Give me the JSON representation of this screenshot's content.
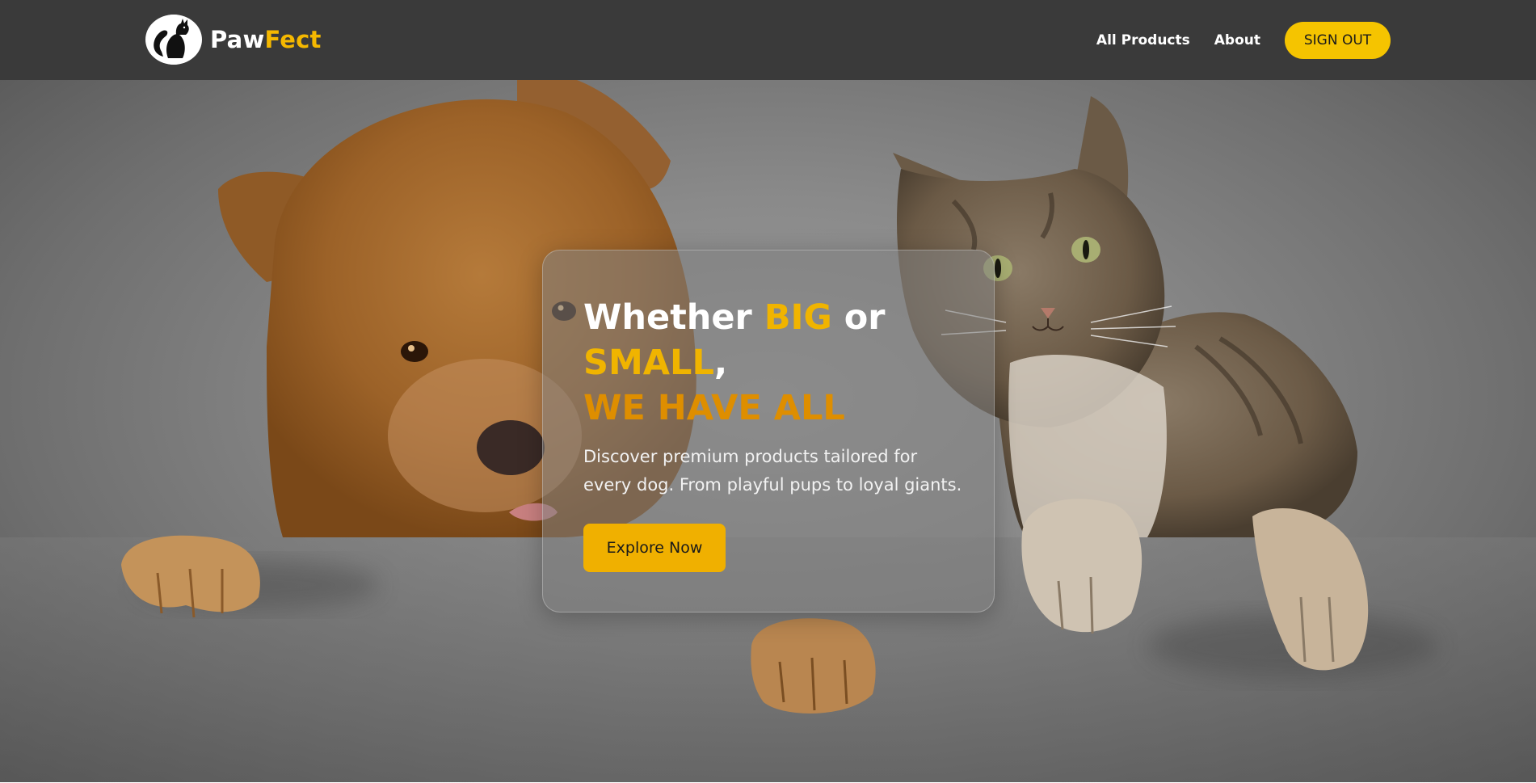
{
  "brand": {
    "name_part1": "Paw",
    "name_part2": "Fect",
    "logo_icon": "cat-silhouette-icon",
    "accent_color": "#f5b800"
  },
  "nav": {
    "links": [
      {
        "label": "All Products"
      },
      {
        "label": "About"
      }
    ],
    "signout_label": "SIGN OUT"
  },
  "hero": {
    "background_icon": "dog-and-cat-photo",
    "headline": {
      "part1": "Whether ",
      "big": "BIG",
      "part2": " or",
      "small": "SMALL",
      "comma": ",",
      "line3": "WE HAVE ALL"
    },
    "description": "Discover premium products tailored for every dog. From playful pups to loyal giants.",
    "cta_label": "Explore Now"
  },
  "colors": {
    "navbar_bg": "#3a3a3a",
    "button_yellow": "#f5c400",
    "headline_orange": "#de8e00"
  }
}
